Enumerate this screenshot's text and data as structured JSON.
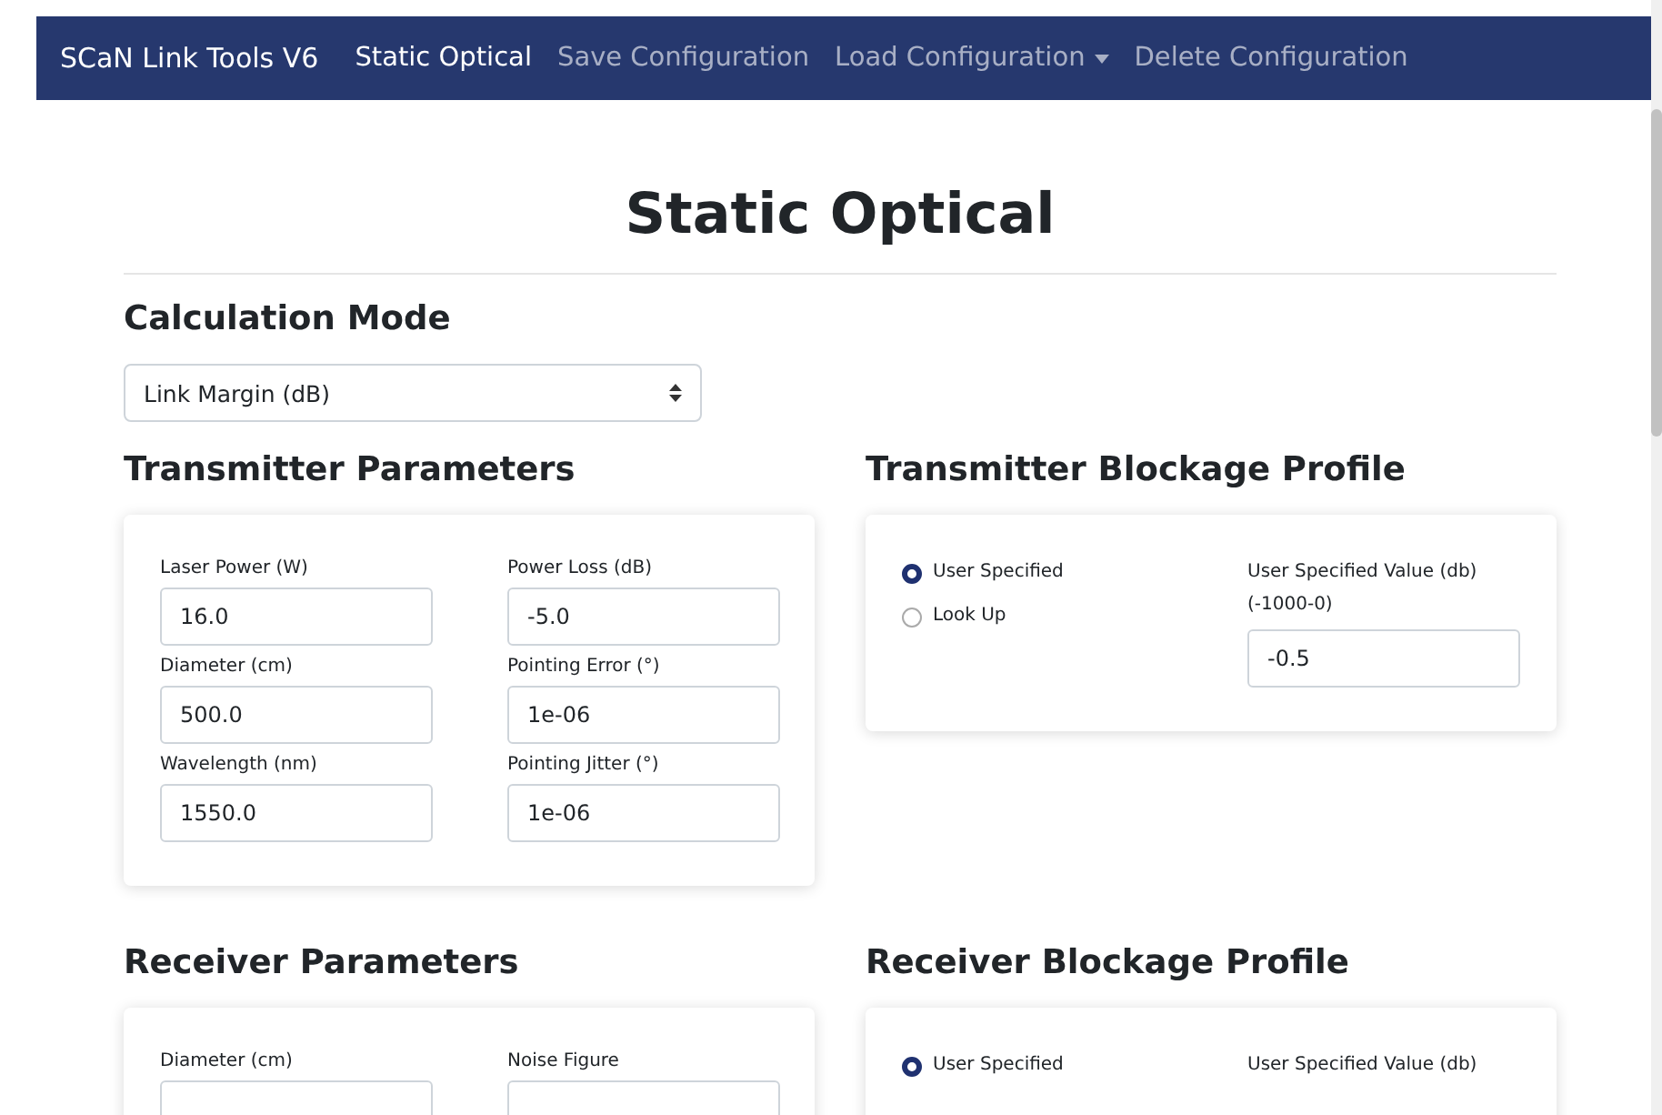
{
  "navbar": {
    "brand": "SCaN Link Tools V6",
    "links": [
      {
        "label": "Static Optical",
        "selected": true,
        "kind": "link"
      },
      {
        "label": "Save Configuration",
        "selected": false,
        "kind": "link"
      },
      {
        "label": "Load Configuration",
        "selected": false,
        "kind": "dropdown"
      },
      {
        "label": "Delete Configuration",
        "selected": false,
        "kind": "link"
      }
    ]
  },
  "title": "Static Optical",
  "calculation_mode": {
    "heading": "Calculation Mode",
    "value": "Link Margin (dB)"
  },
  "sections": [
    {
      "parameters": {
        "heading": "Transmitter Parameters",
        "fields": [
          {
            "label": "Laser Power (W)",
            "value": "16.0"
          },
          {
            "label": "Power Loss (dB)",
            "value": "-5.0"
          },
          {
            "label": "Diameter (cm)",
            "value": "500.0"
          },
          {
            "label": "Pointing Error (°)",
            "value": "1e-06"
          },
          {
            "label": "Wavelength (nm)",
            "value": "1550.0"
          },
          {
            "label": "Pointing Jitter (°)",
            "value": "1e-06"
          }
        ]
      },
      "blockage": {
        "heading": "Transmitter Blockage Profile",
        "options": [
          {
            "label": "User Specified",
            "selected": true
          },
          {
            "label": "Look Up",
            "selected": false
          }
        ],
        "value_label": "User Specified Value (db)",
        "range": "(-1000-0)",
        "value": "-0.5"
      }
    },
    {
      "parameters": {
        "heading": "Receiver Parameters",
        "fields": [
          {
            "label": "Diameter (cm)"
          },
          {
            "label": "Noise Figure"
          }
        ]
      },
      "blockage": {
        "heading": "Receiver Blockage Profile",
        "options": [
          {
            "label": "User Specified",
            "selected": true
          }
        ],
        "value_label": "User Specified Value (db)"
      }
    }
  ]
}
